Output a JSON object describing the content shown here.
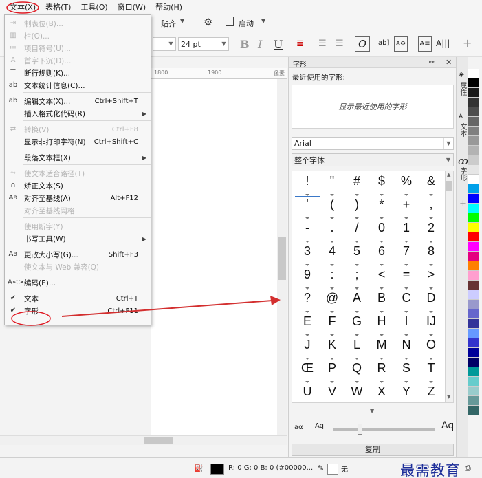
{
  "menubar": {
    "items": [
      "文本(X)",
      "表格(T)",
      "工具(O)",
      "窗口(W)",
      "帮助(H)"
    ]
  },
  "toolbar1": {
    "paste_label": "贴齐",
    "launch_label": "启动"
  },
  "toolbar2": {
    "font_size": "24 pt"
  },
  "ruler": {
    "mark1": "1800",
    "mark2": "1900",
    "unit": "像素"
  },
  "menu": {
    "items": [
      {
        "label": "制表位(B)...",
        "shortcut": "",
        "disabled": true,
        "icon": "tab-stops-icon"
      },
      {
        "label": "栏(O)...",
        "shortcut": "",
        "disabled": true,
        "icon": "columns-icon"
      },
      {
        "label": "项目符号(U)...",
        "shortcut": "",
        "disabled": true,
        "icon": "bullets-icon"
      },
      {
        "label": "首字下沉(D)...",
        "shortcut": "",
        "disabled": true,
        "icon": "drop-cap-icon"
      },
      {
        "label": "断行规则(K)...",
        "shortcut": "",
        "disabled": false,
        "icon": "line-break-icon"
      },
      {
        "label": "文本统计信息(C)...",
        "shortcut": "",
        "disabled": false,
        "icon": "text-stats-icon"
      },
      {
        "label": "编辑文本(X)...",
        "shortcut": "Ctrl+Shift+T",
        "disabled": false,
        "icon": "edit-text-icon"
      },
      {
        "label": "插入格式化代码(R)",
        "shortcut": "",
        "disabled": false,
        "icon": "",
        "submenu": true
      },
      {
        "label": "转换(V)",
        "shortcut": "Ctrl+F8",
        "disabled": true,
        "icon": "convert-icon"
      },
      {
        "label": "显示非打印字符(N)",
        "shortcut": "Ctrl+Shift+C",
        "disabled": false,
        "icon": ""
      },
      {
        "label": "段落文本框(X)",
        "shortcut": "",
        "disabled": false,
        "icon": "",
        "submenu": true
      },
      {
        "label": "使文本适合路径(T)",
        "shortcut": "",
        "disabled": true,
        "icon": "fit-path-icon"
      },
      {
        "label": "矫正文本(S)",
        "shortcut": "",
        "disabled": false,
        "icon": "straighten-icon"
      },
      {
        "label": "对齐至基线(A)",
        "shortcut": "Alt+F12",
        "disabled": false,
        "icon": "baseline-icon"
      },
      {
        "label": "对齐至基线网格",
        "shortcut": "",
        "disabled": true,
        "icon": ""
      },
      {
        "label": "使用断字(Y)",
        "shortcut": "",
        "disabled": true,
        "icon": ""
      },
      {
        "label": "书写工具(W)",
        "shortcut": "",
        "disabled": false,
        "icon": "",
        "submenu": true
      },
      {
        "label": "更改大小写(G)...",
        "shortcut": "Shift+F3",
        "disabled": false,
        "icon": "change-case-icon"
      },
      {
        "label": "使文本与 Web 兼容(Q)",
        "shortcut": "",
        "disabled": true,
        "icon": ""
      },
      {
        "label": "编码(E)...",
        "shortcut": "",
        "disabled": false,
        "icon": "encoding-icon"
      },
      {
        "label": "文本",
        "shortcut": "Ctrl+T",
        "disabled": false,
        "icon": "check-icon"
      },
      {
        "label": "字形",
        "shortcut": "Ctrl+F11",
        "disabled": false,
        "icon": "check-icon"
      }
    ]
  },
  "panel": {
    "title": "字形",
    "recent_label": "最近使用的字形:",
    "recent_placeholder": "显示最近使用的字形",
    "font": "Arial",
    "range": "整个字体",
    "glyphs": [
      "!",
      "\"",
      "#",
      "$",
      "%",
      "&",
      "'",
      "(",
      ")",
      "*",
      "+",
      ",",
      "-",
      ".",
      "/",
      "0",
      "1",
      "2",
      "3",
      "4",
      "5",
      "6",
      "7",
      "8",
      "9",
      ":",
      ";",
      "<",
      "=",
      ">",
      "?",
      "@",
      "A",
      "B",
      "C",
      "D",
      "E",
      "F",
      "G",
      "H",
      "I",
      "IJ",
      "J",
      "K",
      "L",
      "M",
      "N",
      "O",
      "Œ",
      "P",
      "Q",
      "R",
      "S",
      "T",
      "U",
      "V",
      "W",
      "X",
      "Y",
      "Z"
    ],
    "copy_label": "复制"
  },
  "vtabs": {
    "items": [
      "属性",
      "文本",
      "字形"
    ]
  },
  "palette": [
    "#ffffff",
    "#000000",
    "#1a1a1a",
    "#333333",
    "#4d4d4d",
    "#666666",
    "#808080",
    "#999999",
    "#b3b3b3",
    "#cccccc",
    "#e6e6e6",
    "#ffffff",
    "#00a0e9",
    "#0000ff",
    "#00ffff",
    "#00ff00",
    "#ffff00",
    "#ff0000",
    "#ff00ff",
    "#e4007f",
    "#ff7f00",
    "#ff9fcf",
    "#663333",
    "#ccccff",
    "#9999cc",
    "#6666cc",
    "#333399",
    "#6699ff",
    "#3333cc",
    "#000099",
    "#000066",
    "#009999",
    "#66cccc",
    "#99cccc",
    "#669999",
    "#336666"
  ],
  "status": {
    "color_text": "R: 0 G: 0 B: 0 (#00000...",
    "none_label": "无",
    "watermark": "最需教育"
  }
}
